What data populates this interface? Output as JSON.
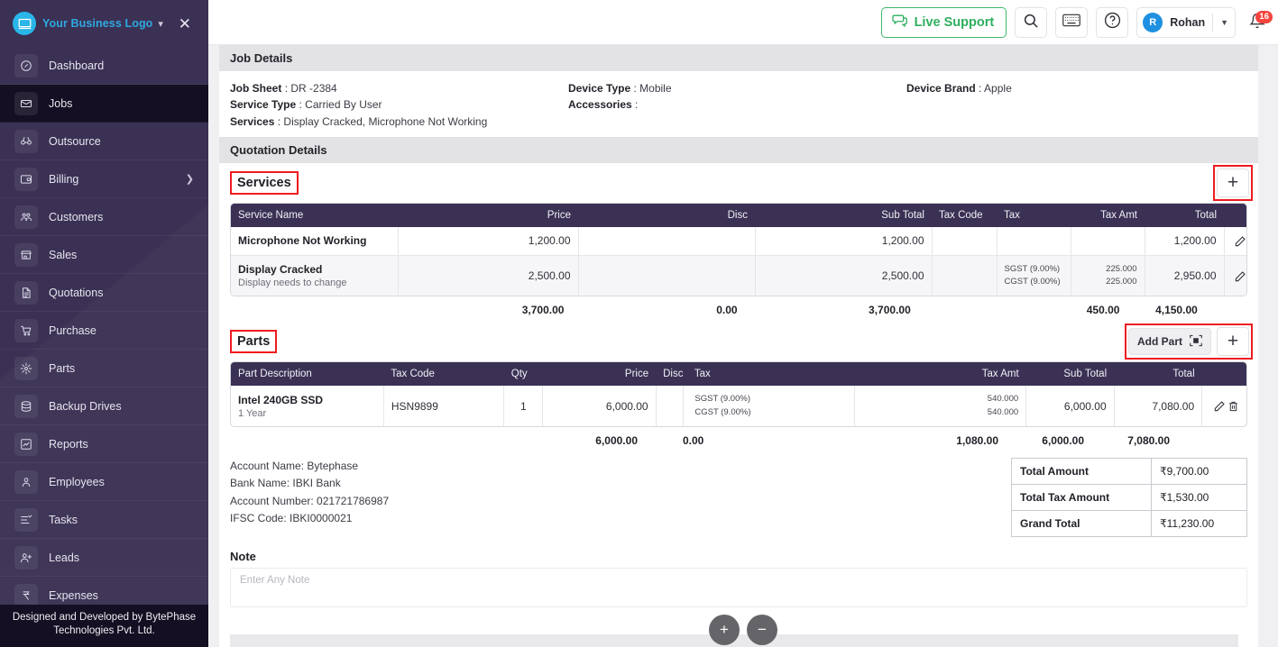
{
  "sidebar": {
    "logo_text": "Your Business Logo",
    "footer_line1": "Designed and Developed by BytePhase",
    "footer_line2": "Technologies Pvt. Ltd.",
    "items": [
      {
        "label": "Dashboard",
        "icon": "dashboard-icon",
        "active": false,
        "chevron": false
      },
      {
        "label": "Jobs",
        "icon": "jobs-icon",
        "active": true,
        "chevron": false
      },
      {
        "label": "Outsource",
        "icon": "outsource-icon",
        "active": false,
        "chevron": false
      },
      {
        "label": "Billing",
        "icon": "billing-icon",
        "active": false,
        "chevron": true
      },
      {
        "label": "Customers",
        "icon": "customers-icon",
        "active": false,
        "chevron": false
      },
      {
        "label": "Sales",
        "icon": "sales-icon",
        "active": false,
        "chevron": false
      },
      {
        "label": "Quotations",
        "icon": "quotations-icon",
        "active": false,
        "chevron": false
      },
      {
        "label": "Purchase",
        "icon": "purchase-icon",
        "active": false,
        "chevron": false
      },
      {
        "label": "Parts",
        "icon": "parts-icon",
        "active": false,
        "chevron": false
      },
      {
        "label": "Backup Drives",
        "icon": "backup-drives-icon",
        "active": false,
        "chevron": false
      },
      {
        "label": "Reports",
        "icon": "reports-icon",
        "active": false,
        "chevron": false
      },
      {
        "label": "Employees",
        "icon": "employees-icon",
        "active": false,
        "chevron": false
      },
      {
        "label": "Tasks",
        "icon": "tasks-icon",
        "active": false,
        "chevron": false
      },
      {
        "label": "Leads",
        "icon": "leads-icon",
        "active": false,
        "chevron": false
      },
      {
        "label": "Expenses",
        "icon": "expenses-icon",
        "active": false,
        "chevron": false
      }
    ]
  },
  "topbar": {
    "live_support": "Live Support",
    "user_name": "Rohan",
    "user_initial": "R",
    "notification_count": "16"
  },
  "job_details": {
    "heading": "Job Details",
    "job_sheet_label": "Job Sheet",
    "job_sheet_value": "DR -2384",
    "service_type_label": "Service Type",
    "service_type_value": "Carried By User",
    "services_label": "Services",
    "services_value": "Display Cracked, Microphone Not Working",
    "device_type_label": "Device Type",
    "device_type_value": "Mobile",
    "accessories_label": "Accessories",
    "accessories_value": "",
    "device_brand_label": "Device Brand",
    "device_brand_value": "Apple"
  },
  "quotation_details": {
    "heading": "Quotation Details"
  },
  "services": {
    "title": "Services",
    "add_button": "+",
    "columns": [
      "Service Name",
      "Price",
      "Disc",
      "Sub Total",
      "Tax Code",
      "Tax",
      "Tax Amt",
      "Total"
    ],
    "rows": [
      {
        "name": "Microphone Not Working",
        "desc": "",
        "price": "1,200.00",
        "disc": "",
        "sub_total": "1,200.00",
        "tax_code": "",
        "tax1": "",
        "tax2": "",
        "tax_amt1": "",
        "tax_amt2": "",
        "total": "1,200.00"
      },
      {
        "name": "Display Cracked",
        "desc": "Display needs to change",
        "price": "2,500.00",
        "disc": "",
        "sub_total": "2,500.00",
        "tax_code": "",
        "tax1": "SGST (9.00%)",
        "tax2": "CGST (9.00%)",
        "tax_amt1": "225.000",
        "tax_amt2": "225.000",
        "total": "2,950.00"
      }
    ],
    "totals": {
      "price": "3,700.00",
      "disc": "0.00",
      "sub_total": "3,700.00",
      "tax_amt": "450.00",
      "total": "4,150.00"
    }
  },
  "parts": {
    "title": "Parts",
    "add_part_button": "Add Part",
    "add_button": "+",
    "columns": [
      "Part Description",
      "Tax Code",
      "Qty",
      "Price",
      "Disc",
      "Tax",
      "Tax Amt",
      "Sub Total",
      "Total"
    ],
    "rows": [
      {
        "name": "Intel 240GB SSD",
        "desc": "1 Year",
        "tax_code": "HSN9899",
        "qty": "1",
        "price": "6,000.00",
        "disc": "",
        "tax1": "SGST (9.00%)",
        "tax2": "CGST (9.00%)",
        "tax_amt1": "540.000",
        "tax_amt2": "540.000",
        "sub_total": "6,000.00",
        "total": "7,080.00"
      }
    ],
    "totals": {
      "price": "6,000.00",
      "disc": "0.00",
      "tax_amt": "1,080.00",
      "sub_total": "6,000.00",
      "total": "7,080.00"
    }
  },
  "bank": {
    "account_name": "Account Name: Bytephase",
    "bank_name": "Bank Name: IBKI Bank",
    "account_number": "Account Number: 021721786987",
    "ifsc_code": "IFSC Code: IBKI0000021"
  },
  "totals_table": {
    "rows": [
      {
        "label": "Total Amount",
        "value": "₹9,700.00"
      },
      {
        "label": "Total Tax Amount",
        "value": "₹1,530.00"
      },
      {
        "label": "Grand Total",
        "value": "₹11,230.00"
      }
    ]
  },
  "note": {
    "label": "Note",
    "placeholder": "Enter Any Note",
    "value": ""
  },
  "fabs": {
    "zoom_in": "+",
    "zoom_out": "−"
  },
  "colors": {
    "sidebar_bg": "#3b3154",
    "sidebar_active": "#140f22",
    "accent_blue": "#2fa8e0",
    "table_header": "#3b3154",
    "highlight_red": "#ee1c20",
    "support_green": "#2fae5f",
    "badge_red": "#f4453f"
  }
}
